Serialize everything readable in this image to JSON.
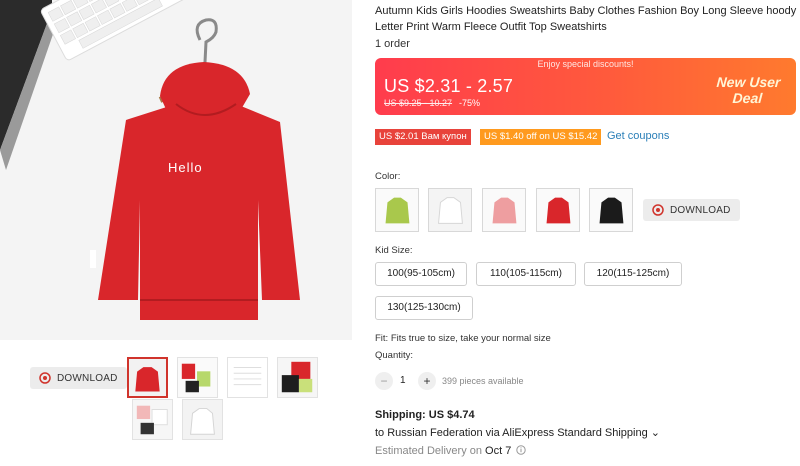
{
  "product": {
    "title": "Autumn Kids Girls Hoodies Sweatshirts Baby Clothes Fashion Boy Long Sleeve hoody Letter Print Warm Fleece Outfit Top Sweatshirts",
    "orders": "1 order",
    "hoodie_print": "Hello"
  },
  "price": {
    "banner_caption": "Enjoy special discounts!",
    "range": "US $2.31 - 2.57",
    "original": "US $9.25 - 10.27",
    "discount": "-75%",
    "badge_line1": "New User",
    "badge_line2": "Deal"
  },
  "coupons": {
    "coupon1": "US $2.01 Вам купон",
    "coupon2": "US $1.40 off on US $15.42",
    "link": "Get coupons"
  },
  "color": {
    "label": "Color:",
    "options": [
      "green",
      "white",
      "pink",
      "red",
      "black"
    ]
  },
  "download_label": "DOWNLOAD",
  "size": {
    "label": "Kid Size:",
    "options": [
      "100(95-105cm)",
      "110(105-115cm)",
      "120(115-125cm)",
      "130(125-130cm)"
    ]
  },
  "fit": "Fit: Fits true to size, take your normal size",
  "quantity": {
    "label": "Quantity:",
    "minus": "−",
    "plus": "+",
    "value": "1",
    "available": "399 pieces available"
  },
  "shipping": {
    "cost": "Shipping: US $4.74",
    "destination": "to Russian Federation via AliExpress Standard Shipping ⌄",
    "delivery_prefix": "Estimated Delivery on ",
    "delivery_date": "Oct 7",
    "info_icon": "info-icon"
  },
  "colors": {
    "accent": "#ff3c4d",
    "hoodie_red": "#d9262b",
    "link": "#2a7fb8"
  }
}
